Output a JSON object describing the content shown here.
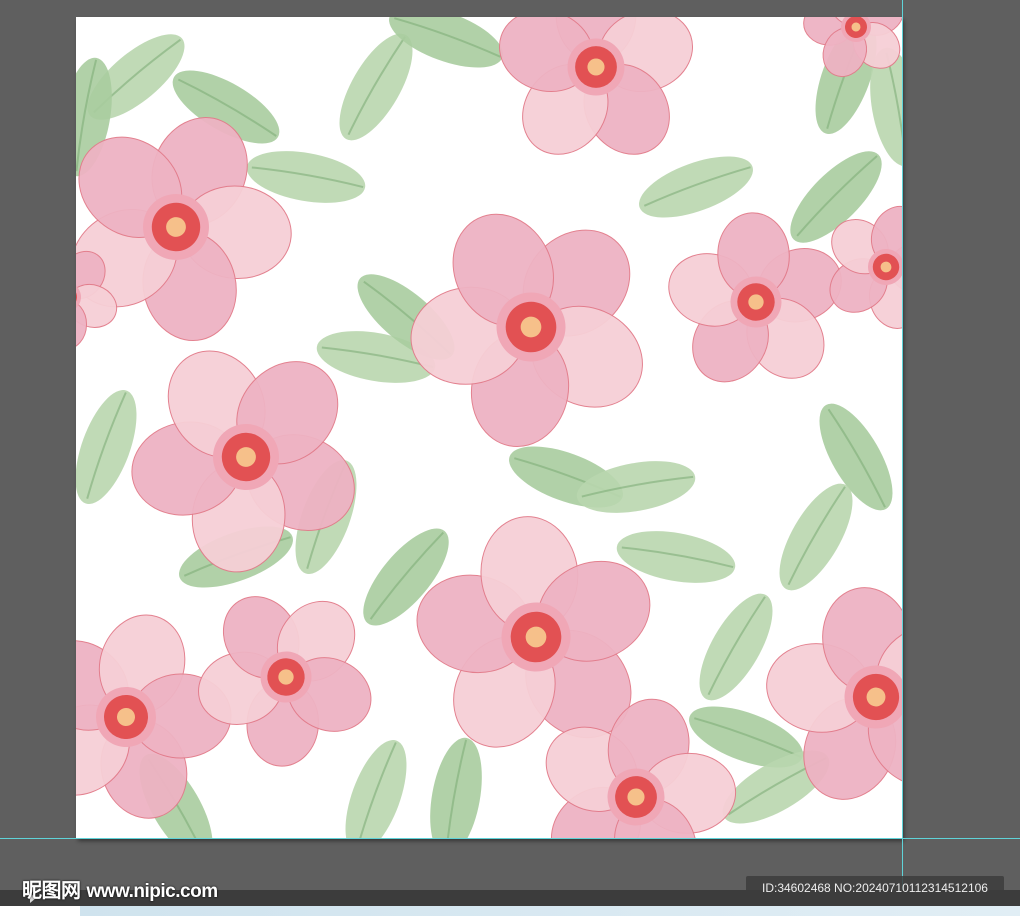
{
  "watermark": {
    "logo_text": "昵图网",
    "url": "www.nipic.com"
  },
  "image_id": "ID:34602468 NO:20240710112314512106",
  "colors": {
    "workspace": "#5f5f5f",
    "guide": "#5fd3d8",
    "petal": "#f6cfd6",
    "petal_dark": "#eeb3c3",
    "center": "#e04848",
    "leaf": "#a9cc9f",
    "leaf_dark": "#7fae78"
  }
}
